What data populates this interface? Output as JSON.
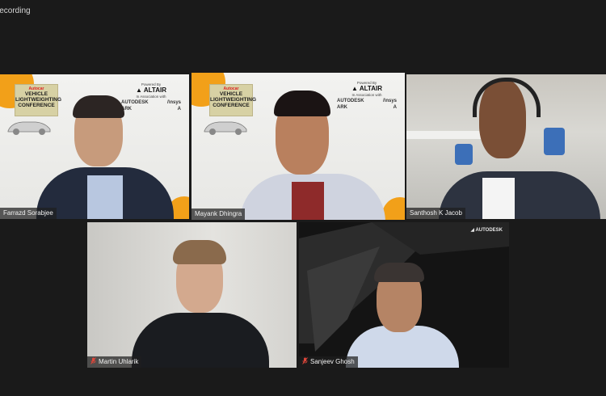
{
  "window": {
    "recording_label": "Recording"
  },
  "conference": {
    "title_tag": "Autocar",
    "title_lines": [
      "VEHICLE",
      "LIGHTWEIGHTING",
      "CONFERENCE"
    ],
    "powered_by": "Powered By",
    "brand": "ALTAIR",
    "association": "In Association with",
    "sponsors_row1": [
      "AUTODESK",
      "/\\nsys"
    ],
    "sponsors_row2": [
      "ARK",
      "A"
    ]
  },
  "participants": [
    {
      "name": "Farrazd Sorabjee",
      "muted": false
    },
    {
      "name": "Mayank Dhingra",
      "muted": false,
      "active_speaker": true
    },
    {
      "name": "Santhosh K Jacob",
      "muted": false
    },
    {
      "name": "Martin Uhlarik",
      "muted": true
    },
    {
      "name": "Sanjeev Ghosh",
      "muted": true
    }
  ],
  "autodesk_watermark": "AUTODESK",
  "colors": {
    "accent_speaker": "#c8e13c",
    "backdrop_orange": "#f2a019",
    "muted_red": "#e0463a"
  }
}
